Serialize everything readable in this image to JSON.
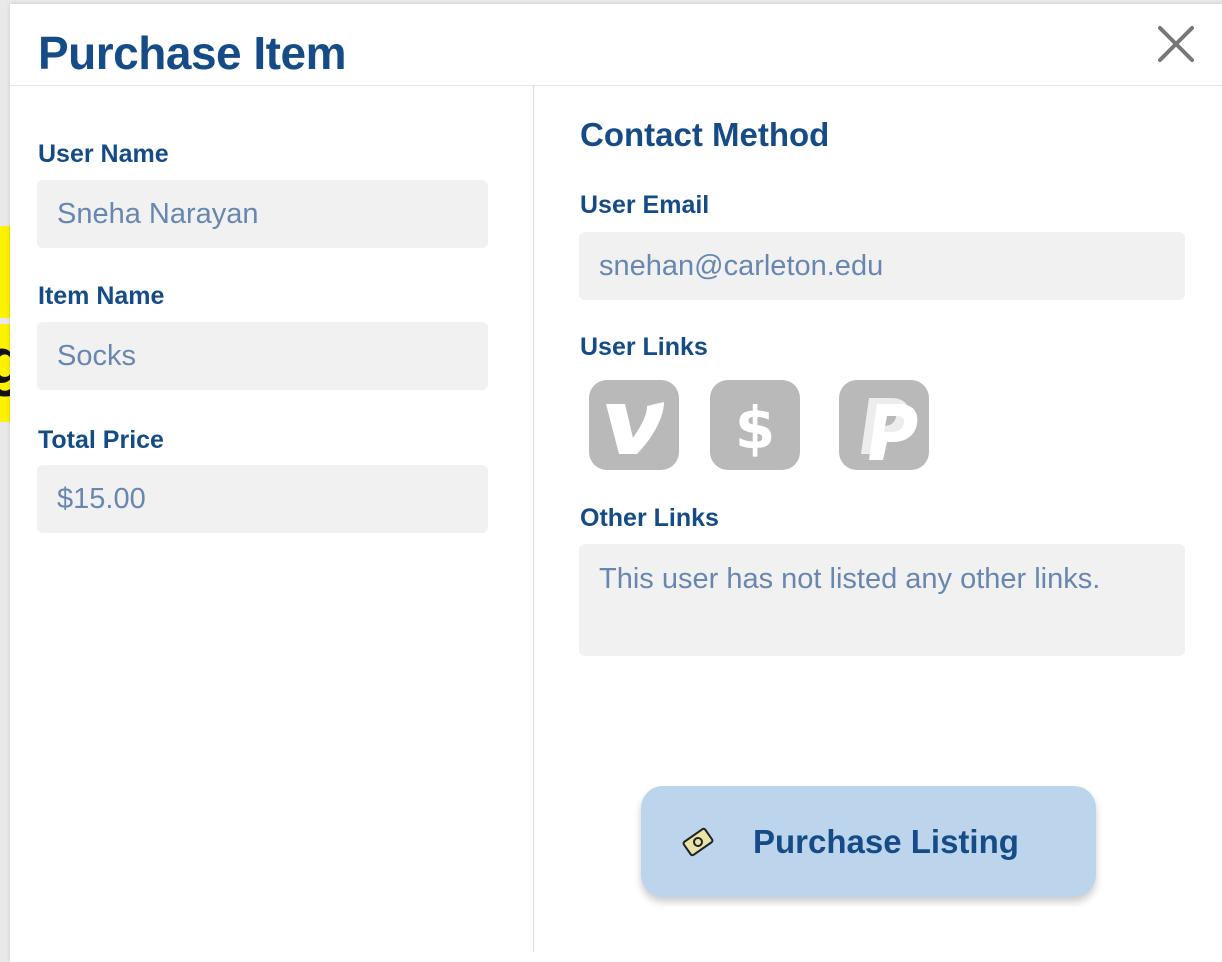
{
  "background": {
    "peek_text": "g"
  },
  "modal": {
    "title": "Purchase Item",
    "close_icon": "close-icon"
  },
  "left_panel": {
    "user_name": {
      "label": "User Name",
      "value": "Sneha Narayan"
    },
    "item_name": {
      "label": "Item Name",
      "value": "Socks"
    },
    "total_price": {
      "label": "Total Price",
      "value": "$15.00"
    }
  },
  "right_panel": {
    "section_title": "Contact Method",
    "user_email": {
      "label": "User Email",
      "value": "snehan@carleton.edu"
    },
    "user_links": {
      "label": "User Links",
      "icons": [
        "venmo-icon",
        "cash-app-icon",
        "paypal-icon"
      ]
    },
    "other_links": {
      "label": "Other Links",
      "value": "This user has not listed any other links."
    }
  },
  "purchase_button": {
    "label": "Purchase Listing",
    "icon": "money-icon"
  },
  "colors": {
    "accent": "#154c87",
    "field_bg": "#f1f1f1",
    "field_text": "#6887b0",
    "button_bg": "#bdd5ec",
    "icon_gray": "#b9b9b9"
  }
}
